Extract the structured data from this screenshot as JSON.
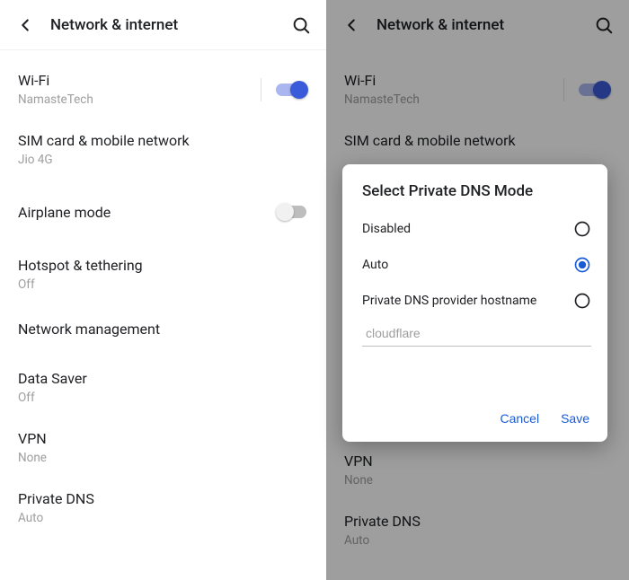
{
  "header": {
    "title": "Network & internet"
  },
  "settings": {
    "wifi": {
      "label": "Wi-Fi",
      "value": "NamasteTech",
      "on": true
    },
    "sim": {
      "label": "SIM card & mobile network",
      "value": "Jio 4G"
    },
    "airplane": {
      "label": "Airplane mode",
      "on": false
    },
    "hotspot": {
      "label": "Hotspot & tethering",
      "value": "Off"
    },
    "netmgmt": {
      "label": "Network management"
    },
    "datasaver": {
      "label": "Data Saver",
      "value": "Off"
    },
    "vpn": {
      "label": "VPN",
      "value": "None"
    },
    "privatedns": {
      "label": "Private DNS",
      "value": "Auto"
    }
  },
  "dialog": {
    "title": "Select Private DNS Mode",
    "options": {
      "disabled": "Disabled",
      "auto": "Auto",
      "hostname": "Private DNS provider hostname"
    },
    "selected": "auto",
    "input_placeholder": "cloudflare",
    "cancel": "Cancel",
    "save": "Save"
  }
}
